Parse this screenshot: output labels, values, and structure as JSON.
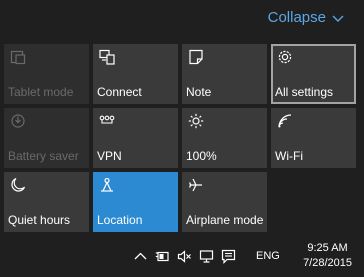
{
  "collapse_label": "Collapse",
  "tiles": [
    {
      "label": "Tablet mode",
      "icon": "tablet-mode-icon",
      "state": "disabled"
    },
    {
      "label": "Connect",
      "icon": "connect-icon",
      "state": "normal"
    },
    {
      "label": "Note",
      "icon": "note-icon",
      "state": "normal"
    },
    {
      "label": "All settings",
      "icon": "gear-icon",
      "state": "selected"
    },
    {
      "label": "Battery saver",
      "icon": "battery-saver-icon",
      "state": "disabled"
    },
    {
      "label": "VPN",
      "icon": "vpn-icon",
      "state": "normal"
    },
    {
      "label": "100%",
      "icon": "brightness-icon",
      "state": "normal"
    },
    {
      "label": "Wi-Fi",
      "icon": "wifi-icon",
      "state": "normal"
    },
    {
      "label": "Quiet hours",
      "icon": "moon-icon",
      "state": "normal"
    },
    {
      "label": "Location",
      "icon": "location-icon",
      "state": "active"
    },
    {
      "label": "Airplane mode",
      "icon": "airplane-icon",
      "state": "normal"
    }
  ],
  "taskbar": {
    "language": "ENG",
    "time": "9:25 AM",
    "date": "7/28/2015"
  },
  "colors": {
    "accent": "#2b8ad1",
    "link": "#5aa7e6",
    "tile": "#3a3a3a",
    "background": "#1f1f1f"
  }
}
